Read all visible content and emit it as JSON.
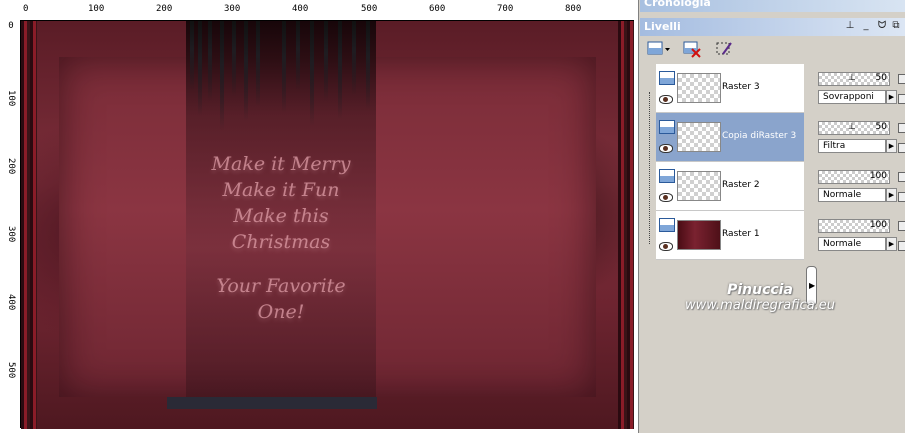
{
  "ruler": {
    "top_labels": [
      "0",
      "100",
      "200",
      "300",
      "400",
      "500",
      "600",
      "700",
      "800"
    ],
    "left_labels": [
      "0",
      "100",
      "200",
      "300",
      "400",
      "500"
    ]
  },
  "canvas": {
    "text_lines": [
      "Make it Merry",
      "Make it Fun",
      "Make this",
      "Christmas",
      "Your Favorite",
      "One!"
    ]
  },
  "panels": {
    "cronologia_title": "Cronologia",
    "livelli_title": "Livelli",
    "title_buttons": [
      "pin-icon",
      "minimize-icon",
      "pin-icon",
      "close-icon"
    ]
  },
  "toolbar": {
    "icons": [
      "new-layer-icon",
      "delete-layer-icon",
      "edit-layer-icon"
    ]
  },
  "layers": [
    {
      "name": "Raster 3",
      "thumb": "transparent",
      "selected": false,
      "opacity": "50",
      "opacity_level": 0.5,
      "blend": "Sovrapponi"
    },
    {
      "name": "Copia diRaster 3",
      "thumb": "transparent",
      "selected": true,
      "opacity": "50",
      "opacity_level": 0.5,
      "blend": "Filtra"
    },
    {
      "name": "Raster 2",
      "thumb": "transparent",
      "selected": false,
      "opacity": "100",
      "opacity_level": 1.0,
      "blend": "Normale"
    },
    {
      "name": "Raster 1",
      "thumb": "texture-red",
      "selected": false,
      "opacity": "100",
      "opacity_level": 1.0,
      "blend": "Normale"
    }
  ],
  "watermark": {
    "line1": "Pinuccia",
    "line2": "www.maldiregrafica.eu"
  },
  "colors": {
    "accent": "#8aa4cc",
    "canvas_red": "#7e2f3b",
    "text_pink": "#e2a0aa"
  }
}
